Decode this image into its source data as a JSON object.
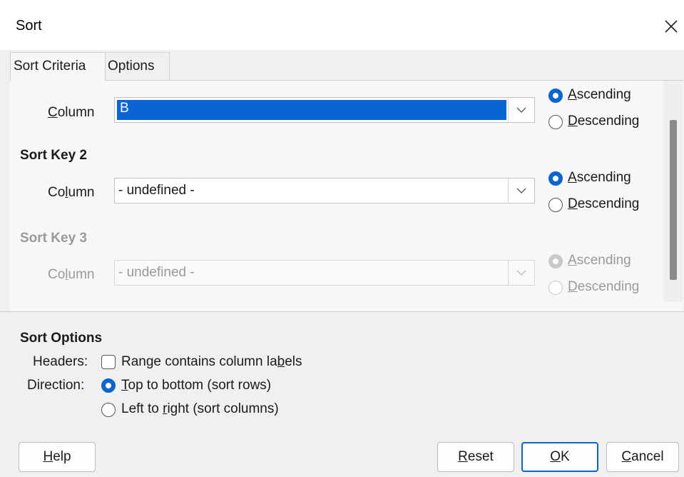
{
  "window": {
    "title": "Sort"
  },
  "tabs": [
    {
      "label": "Sort Criteria",
      "active": true
    },
    {
      "label": "Options",
      "active": false
    }
  ],
  "sort_key_1": {
    "column_label": "Column",
    "column_value": "B",
    "ascending": "Ascending",
    "descending": "Descending",
    "selected": "Ascending"
  },
  "sort_key_2": {
    "heading": "Sort Key 2",
    "column_label": "Column",
    "column_value": "- undefined -",
    "ascending": "Ascending",
    "descending": "Descending",
    "selected": "Ascending"
  },
  "sort_key_3": {
    "heading": "Sort Key 3",
    "column_label": "Column",
    "column_value": "- undefined -",
    "ascending": "Ascending",
    "descending": "Descending",
    "selected": "Ascending",
    "disabled": true
  },
  "sort_options": {
    "heading": "Sort Options",
    "headers_label": "Headers:",
    "headers_checkbox": "Range contains column labels",
    "headers_checked": false,
    "direction_label": "Direction:",
    "direction_top_bottom": "Top to bottom (sort rows)",
    "direction_left_right": "Left to right (sort columns)",
    "direction_selected": "Top to bottom (sort rows)"
  },
  "buttons": {
    "help": "Help",
    "reset": "Reset",
    "ok": "OK",
    "cancel": "Cancel"
  },
  "colors": {
    "accent": "#0a64d4",
    "dialog_background": "#f0f0f0",
    "disabled_text": "#9a9a9a"
  }
}
